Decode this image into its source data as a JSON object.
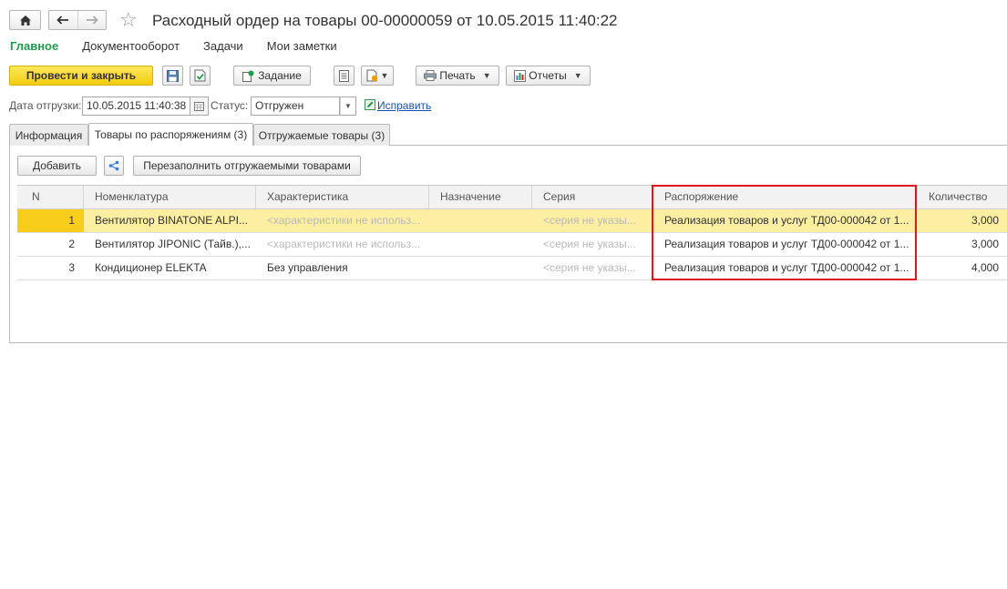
{
  "header": {
    "title": "Расходный ордер на товары 00-00000059 от 10.05.2015 11:40:22"
  },
  "section_menu": {
    "items": [
      "Главное",
      "Документооборот",
      "Задачи",
      "Мои заметки"
    ]
  },
  "command_bar": {
    "post_and_close": "Провести и закрыть",
    "task": "Задание",
    "print": "Печать",
    "reports": "Отчеты"
  },
  "fields": {
    "shipment_date_label": "Дата отгрузки:",
    "shipment_date_value": "10.05.2015 11:40:38",
    "status_label": "Статус:",
    "status_value": "Отгружен",
    "fix_link": "Исправить"
  },
  "tabs": [
    {
      "label": "Информация"
    },
    {
      "label": "Товары по распоряжениям (3)"
    },
    {
      "label": "Отгружаемые товары (3)"
    }
  ],
  "table_toolbar": {
    "add": "Добавить",
    "refill": "Перезаполнить отгружаемыми товарами"
  },
  "table": {
    "columns": [
      "N",
      "Номенклатура",
      "Характеристика",
      "Назначение",
      "Серия",
      "Распоряжение",
      "Количество"
    ],
    "rows": [
      {
        "n": "1",
        "item": "Вентилятор BINATONE ALPI...",
        "characteristic": "<характеристики не использ...",
        "purpose": "",
        "series": "<серия не указы...",
        "order": "Реализация товаров и услуг ТД00-000042 от 1...",
        "qty": "3,000"
      },
      {
        "n": "2",
        "item": "Вентилятор JIPONIC (Тайв.),...",
        "characteristic": "<характеристики не использ...",
        "purpose": "",
        "series": "<серия не указы...",
        "order": "Реализация товаров и услуг ТД00-000042 от 1...",
        "qty": "3,000"
      },
      {
        "n": "3",
        "item": "Кондиционер ELEKTA",
        "characteristic": "Без управления",
        "purpose": "",
        "series": "<серия не указы...",
        "order": "Реализация товаров и услуг ТД00-000042 от 1...",
        "qty": "4,000"
      }
    ]
  },
  "colors": {
    "accent_green": "#1e9b4b",
    "primary_button": "#f8cd1c",
    "selected_row": "#fcefa1",
    "highlight_box": "#e0161d",
    "link": "#1a4fb5"
  },
  "icons": [
    "home-icon",
    "back-arrow-icon",
    "forward-arrow-icon",
    "star-icon",
    "save-icon",
    "post-icon",
    "task-icon",
    "list-icon",
    "create-based-on-icon",
    "print-icon",
    "reports-icon",
    "calendar-icon",
    "dropdown-icon",
    "edit-icon",
    "structure-icon"
  ]
}
